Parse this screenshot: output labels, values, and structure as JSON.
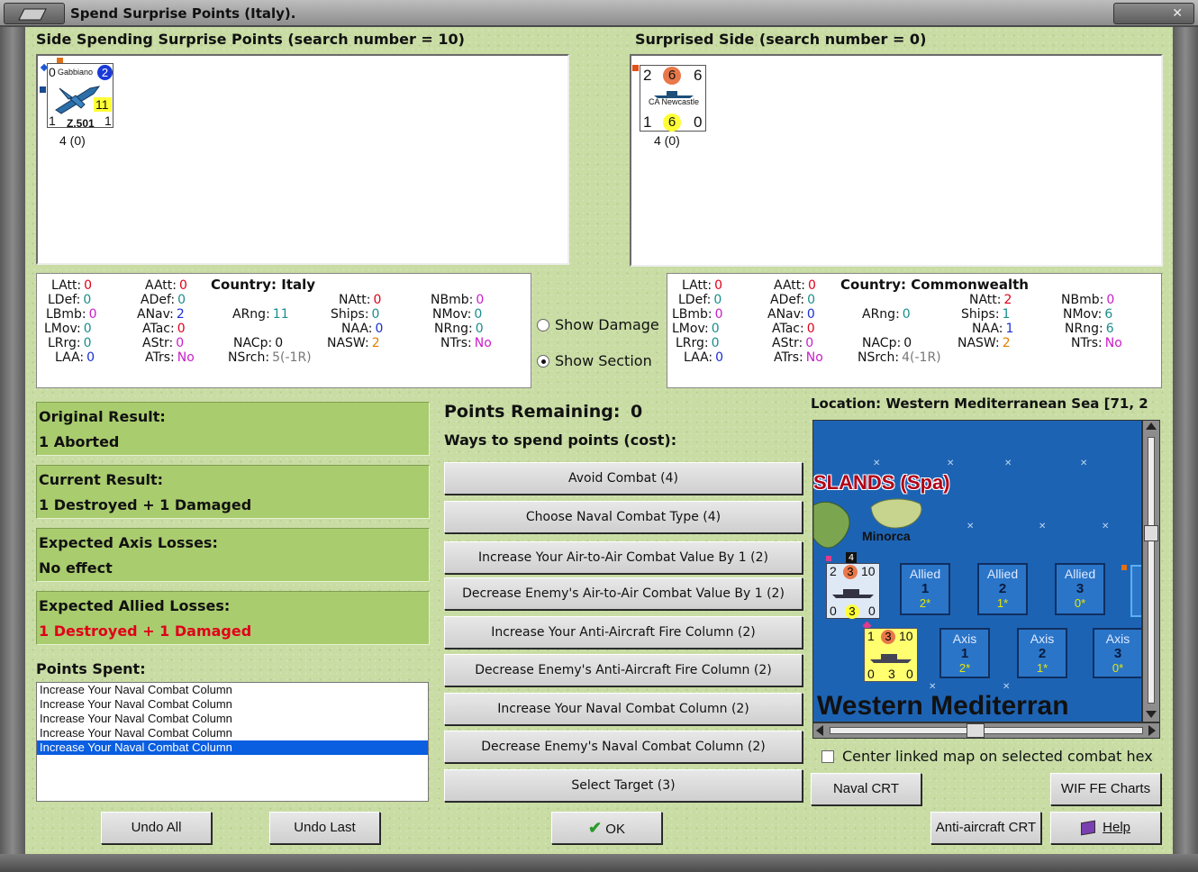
{
  "window": {
    "title": "Spend Surprise Points (Italy)."
  },
  "left_panel": {
    "header": "Side Spending Surprise Points (search number = 10)",
    "counter": {
      "top_left": "0",
      "name": "Gabbiano",
      "top_right": "2",
      "mid_right": "11",
      "bottom_left": "1",
      "id": "Z.501",
      "bottom_right": "1",
      "caption": "4 (0)",
      "bg_color": "#c7e07e"
    }
  },
  "right_panel": {
    "header": "Surprised Side (search number = 0)",
    "counter": {
      "top_left": "2",
      "top_mid": "6",
      "top_right": "6",
      "name": "CA Newcastle",
      "bottom_left": "1",
      "bottom_mid": "6",
      "bottom_right": "0",
      "caption": "4 (0)",
      "bg_color": "#39a4dc"
    }
  },
  "left_stats": {
    "latt": {
      "label": "LAtt:",
      "value": "0"
    },
    "ldef": {
      "label": "LDef:",
      "value": "0"
    },
    "lbmb": {
      "label": "LBmb:",
      "value": "0"
    },
    "lmov": {
      "label": "LMov:",
      "value": "0"
    },
    "lrrg": {
      "label": "LRrg:",
      "value": "0"
    },
    "laa": {
      "label": "LAA:",
      "value": "0"
    },
    "aatt": {
      "label": "AAtt:",
      "value": "0"
    },
    "adef": {
      "label": "ADef:",
      "value": "0"
    },
    "anav": {
      "label": "ANav:",
      "value": "2"
    },
    "atac": {
      "label": "ATac:",
      "value": "0"
    },
    "astr": {
      "label": "AStr:",
      "value": "0"
    },
    "atrs": {
      "label": "ATrs:",
      "value": "No"
    },
    "country": {
      "label": "Country:",
      "value": "Italy"
    },
    "arng": {
      "label": "ARng:",
      "value": "11"
    },
    "nacp": {
      "label": "NACp:",
      "value": "0"
    },
    "nsrch": {
      "label": "NSrch:",
      "value": "5(-1R)"
    },
    "natt": {
      "label": "NAtt:",
      "value": "0"
    },
    "ships": {
      "label": "Ships:",
      "value": "0"
    },
    "naa": {
      "label": "NAA:",
      "value": "0"
    },
    "nasw": {
      "label": "NASW:",
      "value": "2"
    },
    "nbmb": {
      "label": "NBmb:",
      "value": "0"
    },
    "nmov": {
      "label": "NMov:",
      "value": "0"
    },
    "nrng": {
      "label": "NRng:",
      "value": "0"
    },
    "ntrs": {
      "label": "NTrs:",
      "value": "No"
    }
  },
  "right_stats": {
    "latt": {
      "label": "LAtt:",
      "value": "0"
    },
    "ldef": {
      "label": "LDef:",
      "value": "0"
    },
    "lbmb": {
      "label": "LBmb:",
      "value": "0"
    },
    "lmov": {
      "label": "LMov:",
      "value": "0"
    },
    "lrrg": {
      "label": "LRrg:",
      "value": "0"
    },
    "laa": {
      "label": "LAA:",
      "value": "0"
    },
    "aatt": {
      "label": "AAtt:",
      "value": "0"
    },
    "adef": {
      "label": "ADef:",
      "value": "0"
    },
    "anav": {
      "label": "ANav:",
      "value": "0"
    },
    "atac": {
      "label": "ATac:",
      "value": "0"
    },
    "astr": {
      "label": "AStr:",
      "value": "0"
    },
    "atrs": {
      "label": "ATrs:",
      "value": "No"
    },
    "country": {
      "label": "Country:",
      "value": "Commonwealth"
    },
    "arng": {
      "label": "ARng:",
      "value": "0"
    },
    "nacp": {
      "label": "NACp:",
      "value": "0"
    },
    "nsrch": {
      "label": "NSrch:",
      "value": "4(-1R)"
    },
    "natt": {
      "label": "NAtt:",
      "value": "2"
    },
    "ships": {
      "label": "Ships:",
      "value": "1"
    },
    "naa": {
      "label": "NAA:",
      "value": "1"
    },
    "nasw": {
      "label": "NASW:",
      "value": "2"
    },
    "nbmb": {
      "label": "NBmb:",
      "value": "0"
    },
    "nmov": {
      "label": "NMov:",
      "value": "6"
    },
    "nrng": {
      "label": "NRng:",
      "value": "6"
    },
    "ntrs": {
      "label": "NTrs:",
      "value": "No"
    }
  },
  "options": {
    "show_damage": {
      "label": "Show Damage",
      "checked": false
    },
    "show_section": {
      "label": "Show Section",
      "checked": true
    }
  },
  "results": {
    "original": {
      "label": "Original Result:",
      "value": "1 Aborted"
    },
    "current": {
      "label": "Current Result:",
      "value": "1 Destroyed + 1 Damaged"
    },
    "axis_losses": {
      "label": "Expected Axis Losses:",
      "value": "No effect"
    },
    "allied_losses": {
      "label": "Expected Allied Losses:",
      "value": "1 Destroyed + 1 Damaged",
      "value_color": "#e0001a"
    }
  },
  "points_spent": {
    "label": "Points Spent:",
    "items": [
      "Increase Your Naval Combat Column",
      "Increase Your Naval Combat Column",
      "Increase Your Naval Combat Column",
      "Increase Your Naval Combat Column",
      "Increase Your Naval Combat Column"
    ],
    "selected_index": 4
  },
  "spend": {
    "points_label": "Points Remaining:",
    "points_value": "0",
    "ways_label": "Ways to spend points (cost):",
    "buttons": [
      "Avoid Combat (4)",
      "Choose Naval Combat Type (4)",
      "Increase Your Air-to-Air Combat Value By 1 (2)",
      "Decrease Enemy's Air-to-Air Combat Value By 1 (2)",
      "Increase Your Anti-Aircraft Fire Column (2)",
      "Decrease Enemy's Anti-Aircraft Fire Column (2)",
      "Increase Your Naval Combat Column (2)",
      "Decrease Enemy's Naval Combat Column (2)",
      "Select Target (3)"
    ]
  },
  "map": {
    "location": "Location: Western Mediterranean Sea [71, 2",
    "region_label": "SLANDS (Spa)",
    "island_label": "Minorca",
    "sea_label": "Western Mediterran",
    "stack_count": "4",
    "allied_boxes": [
      {
        "side": "Allied",
        "num": "1",
        "sub": "2*"
      },
      {
        "side": "Allied",
        "num": "2",
        "sub": "1*"
      },
      {
        "side": "Allied",
        "num": "3",
        "sub": "0*"
      }
    ],
    "axis_boxes": [
      {
        "side": "Axis",
        "num": "1",
        "sub": "2*"
      },
      {
        "side": "Axis",
        "num": "2",
        "sub": "1*"
      },
      {
        "side": "Axis",
        "num": "3",
        "sub": "0*"
      }
    ],
    "allied_counter": {
      "tl": "2",
      "tm": "3",
      "tr": "10",
      "bl": "0",
      "bm": "3",
      "br": "0"
    },
    "axis_counter": {
      "tl": "1",
      "tm": "3",
      "tr": "10",
      "bl": "0",
      "bm": "3",
      "br": "0"
    },
    "center_linked": {
      "label": "Center linked map on selected combat hex",
      "checked": false
    },
    "scroll": {
      "vertical_position": 0.38,
      "horizontal_position": 0.48
    }
  },
  "bottom_buttons": {
    "undo_all": "Undo All",
    "undo_last": "Undo Last",
    "ok": "OK",
    "naval_crt": "Naval CRT",
    "wif_fe_charts": "WIF FE Charts",
    "anti_aircraft_crt": "Anti-aircraft CRT",
    "help": "Help"
  }
}
